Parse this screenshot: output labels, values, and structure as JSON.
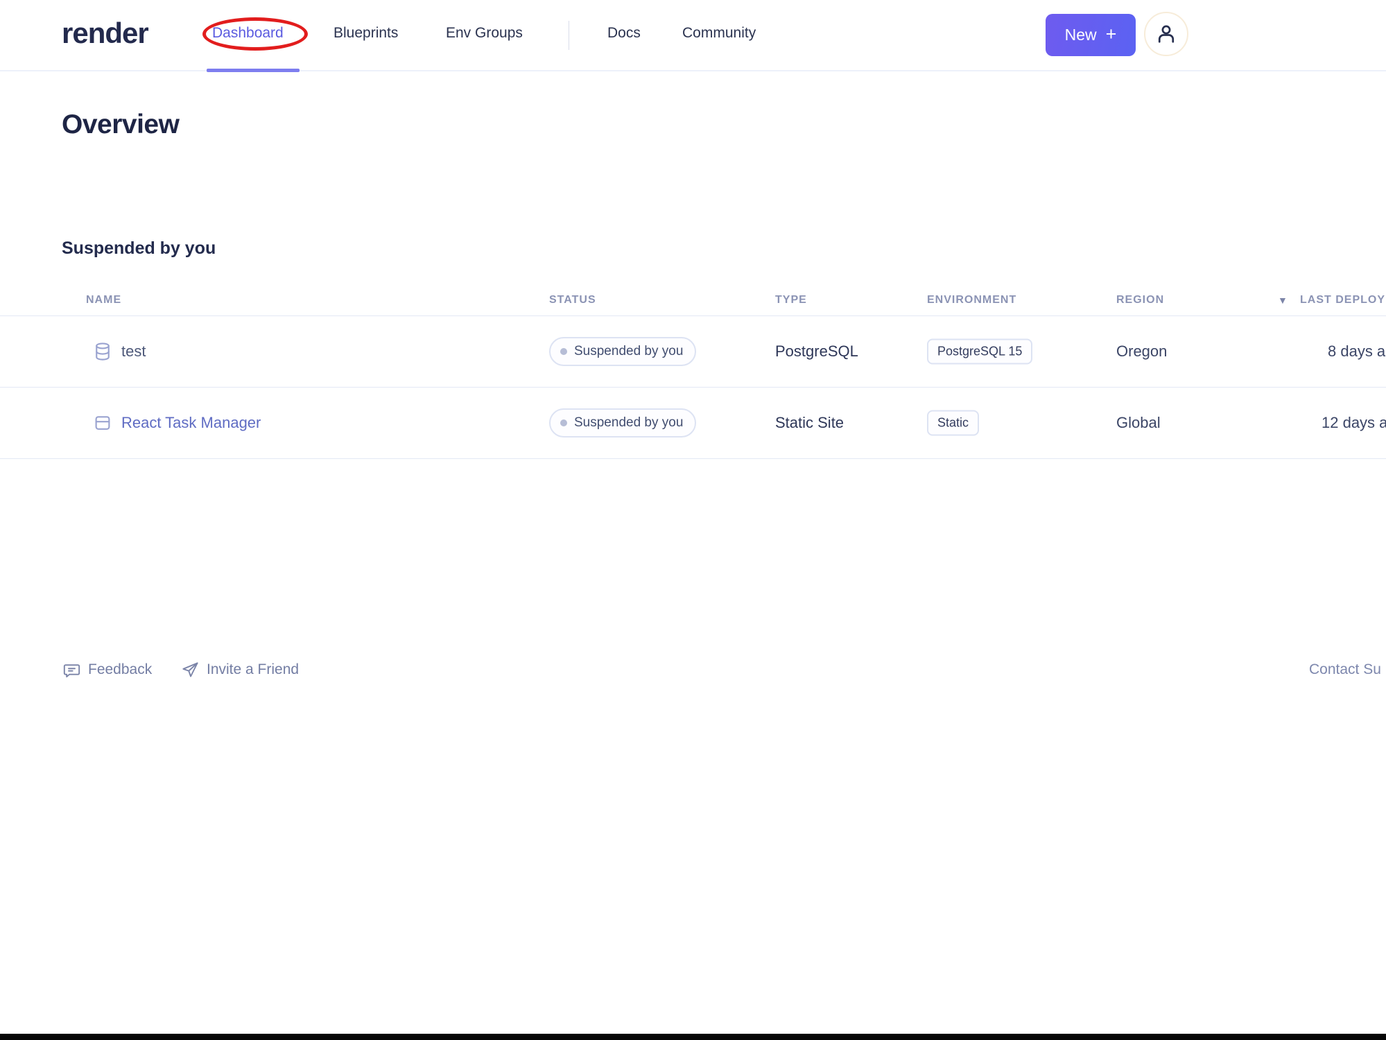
{
  "brand": {
    "logo_text": "render"
  },
  "nav": {
    "items": [
      {
        "label": "Dashboard",
        "active": true
      },
      {
        "label": "Blueprints",
        "active": false
      },
      {
        "label": "Env Groups",
        "active": false
      },
      {
        "label": "Docs",
        "active": false
      },
      {
        "label": "Community",
        "active": false
      }
    ]
  },
  "actions": {
    "new_button_label": "New",
    "new_button_plus": "+"
  },
  "page": {
    "title": "Overview",
    "section_title": "Suspended by you"
  },
  "table": {
    "headers": {
      "name": "NAME",
      "status": "STATUS",
      "type": "TYPE",
      "environment": "ENVIRONMENT",
      "region": "REGION",
      "last_deploy": "LAST DEPLOY"
    },
    "sort": {
      "column": "LAST DEPLOY",
      "direction": "desc",
      "icon": "▼"
    },
    "rows": [
      {
        "icon": "database-icon",
        "name": "test",
        "status": "Suspended by you",
        "type": "PostgreSQL",
        "environment": "PostgreSQL 15",
        "region": "Oregon",
        "last_deploy": "8 days a"
      },
      {
        "icon": "static-site-icon",
        "name": "React Task Manager",
        "status": "Suspended by you",
        "type": "Static Site",
        "environment": "Static",
        "region": "Global",
        "last_deploy": "12 days a"
      }
    ]
  },
  "footer": {
    "feedback": "Feedback",
    "invite": "Invite a Friend",
    "contact_support": "Contact Su"
  },
  "annotation": {
    "type": "red-ellipse",
    "around": "Dashboard nav item",
    "color": "#e21d1d"
  },
  "colors": {
    "accent_purple": "#5b5be0",
    "active_underline": "#7d7def",
    "button_gradient_start": "#6e5bef",
    "button_gradient_end": "#5b62f2",
    "link_blue": "#5f6cc3",
    "badge_border": "#dde3f3",
    "row_divider": "#e3e8f5",
    "muted_header_text": "#8b93b4",
    "dark_text": "#1e2545",
    "footer_text": "#737da3",
    "bottom_bar": "#050505"
  }
}
